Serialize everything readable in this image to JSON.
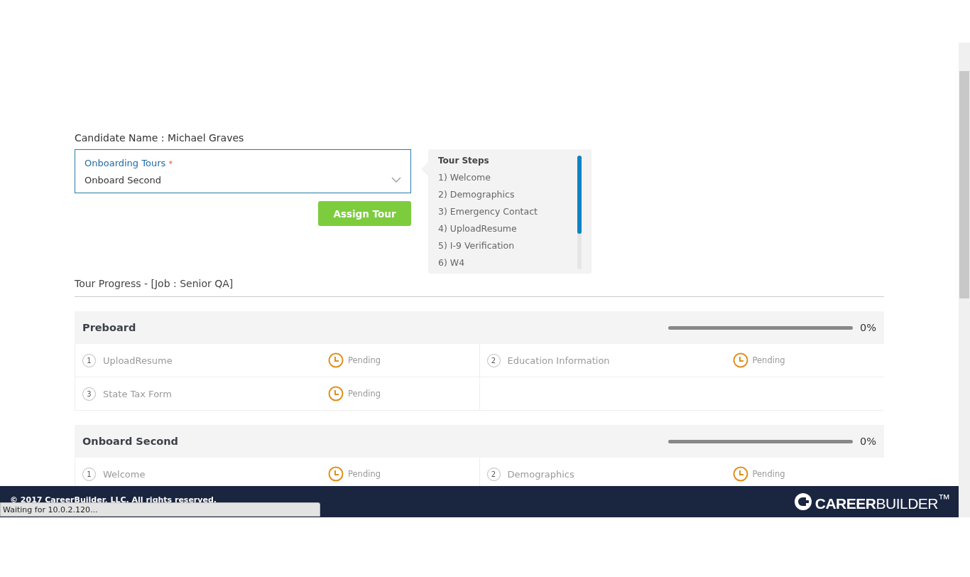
{
  "candidate": {
    "label": "Candidate Name : Michael Graves"
  },
  "tour_select": {
    "label": "Onboarding Tours",
    "required_mark": "*",
    "value": "Onboard Second"
  },
  "assign_button": "Assign Tour",
  "tour_steps": {
    "title": "Tour Steps",
    "items": [
      "1) Welcome",
      "2) Demographics",
      "3) Emergency Contact",
      "4) UploadResume",
      "5) I-9 Verification",
      "6) W4"
    ]
  },
  "progress_heading": "Tour Progress - [Job : Senior QA]",
  "sections": [
    {
      "title": "Preboard",
      "level": 0,
      "percent": "0%",
      "steps": [
        {
          "number": "1",
          "name": "UploadResume",
          "status": "Pending"
        },
        {
          "number": "2",
          "name": "Education Information",
          "status": "Pending"
        },
        {
          "number": "3",
          "name": "State Tax Form",
          "status": "Pending"
        }
      ]
    },
    {
      "title": "Onboard Second",
      "level": 0,
      "percent": "0%",
      "steps": [
        {
          "number": "1",
          "name": "Welcome",
          "status": "Pending"
        },
        {
          "number": "2",
          "name": "Demographics",
          "status": "Pending"
        }
      ]
    }
  ],
  "footer": {
    "copyright": "© 2017 CareerBuilder, LLC. All rights reserved.",
    "logo": "**CAREER**BUILDER$^{™}$"
  },
  "status_bubble": "Waiting for 10.0.2.120..."
}
